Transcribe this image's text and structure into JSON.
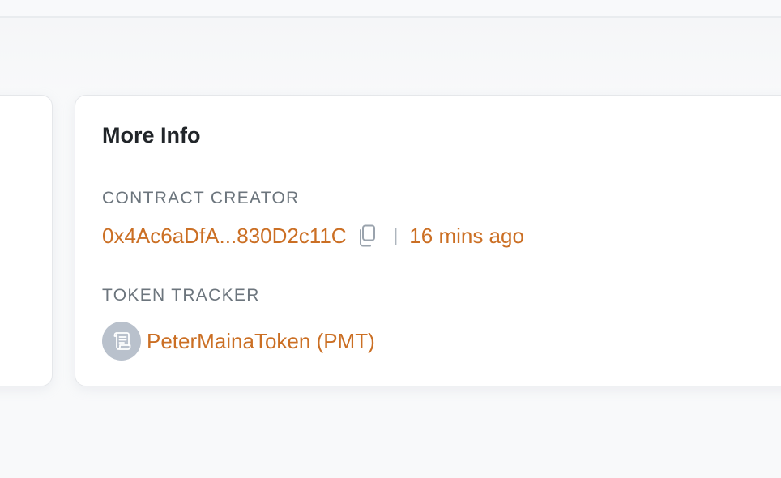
{
  "more_info": {
    "title": "More Info",
    "contract_creator": {
      "label": "CONTRACT CREATOR",
      "address": "0x4Ac6aDfA...830D2c11C",
      "separator": "|",
      "time_ago": "16 mins ago",
      "copy_icon": "copy-icon"
    },
    "token_tracker": {
      "label": "TOKEN TRACKER",
      "token_name": "PeterMainaToken (PMT)",
      "token_icon": "scroll-icon"
    }
  },
  "colors": {
    "link": "#cb6f24",
    "label": "#6c757d",
    "title": "#212529",
    "avatar_bg": "#b9c1cc"
  }
}
